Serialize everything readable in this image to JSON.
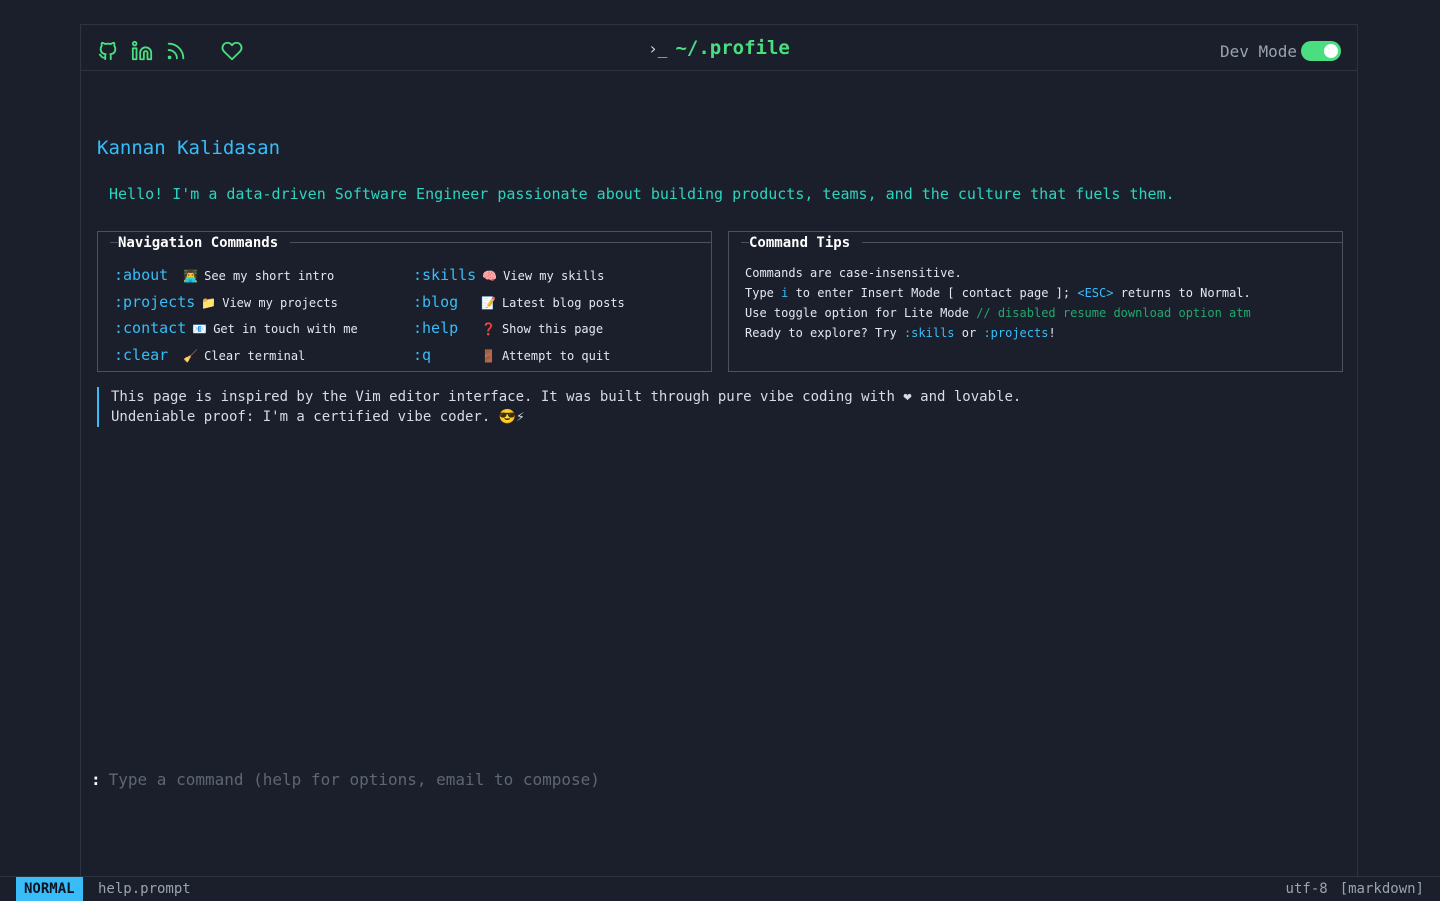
{
  "header": {
    "title_prompt": "›_",
    "title": "~/.profile",
    "devmode_label": "Dev Mode",
    "devmode_on": true,
    "icons": [
      "github-icon",
      "linkedin-icon",
      "rss-icon",
      "heart-icon"
    ]
  },
  "profile": {
    "name": "Kannan Kalidasan",
    "intro": "Hello! I'm a data-driven Software Engineer passionate about building products, teams, and the culture that fuels them."
  },
  "nav": {
    "heading": "Navigation Commands",
    "commands": [
      {
        "cmd": ":about",
        "icon": "👨‍💻",
        "desc": "See my short intro"
      },
      {
        "cmd": ":projects",
        "icon": "📁",
        "desc": "View my projects"
      },
      {
        "cmd": ":contact",
        "icon": "📧",
        "desc": "Get in touch with me"
      },
      {
        "cmd": ":clear",
        "icon": "🧹",
        "desc": "Clear terminal"
      },
      {
        "cmd": ":skills",
        "icon": "🧠",
        "desc": "View my skills"
      },
      {
        "cmd": ":blog",
        "icon": "📝",
        "desc": "Latest blog posts"
      },
      {
        "cmd": ":help",
        "icon": "❓",
        "desc": "Show this page"
      },
      {
        "cmd": ":q",
        "icon": "🚪",
        "desc": "Attempt to quit"
      }
    ]
  },
  "tips": {
    "heading": "Command Tips",
    "line1": "Commands are case-insensitive.",
    "line2_a": "Type ",
    "line2_key": "i",
    "line2_b": " to enter Insert Mode [ contact page ]; ",
    "line2_esc": "<ESC>",
    "line2_c": " returns to Normal.",
    "line3_a": "Use toggle option for Lite Mode ",
    "line3_comment": "// disabled resume download option atm",
    "line4_a": "Ready to explore? Try ",
    "line4_k1": ":skills",
    "line4_b": " or ",
    "line4_k2": ":projects",
    "line4_c": "!"
  },
  "quote": {
    "line1": "This page is inspired by the Vim editor interface. It was built through pure vibe coding with ❤ and lovable.",
    "line2": "Undeniable proof: I'm a certified vibe coder. 😎⚡"
  },
  "command_line": {
    "prompt": ":",
    "placeholder": "Type a command (help for options, email to compose)"
  },
  "statusbar": {
    "mode": "NORMAL",
    "file": "help.prompt",
    "encoding": "utf-8",
    "filetype": "[markdown]"
  },
  "colors": {
    "background": "#1a1f2b",
    "accent_green": "#4ade80",
    "accent_blue": "#38bdf8",
    "accent_teal": "#2dd4bf"
  }
}
